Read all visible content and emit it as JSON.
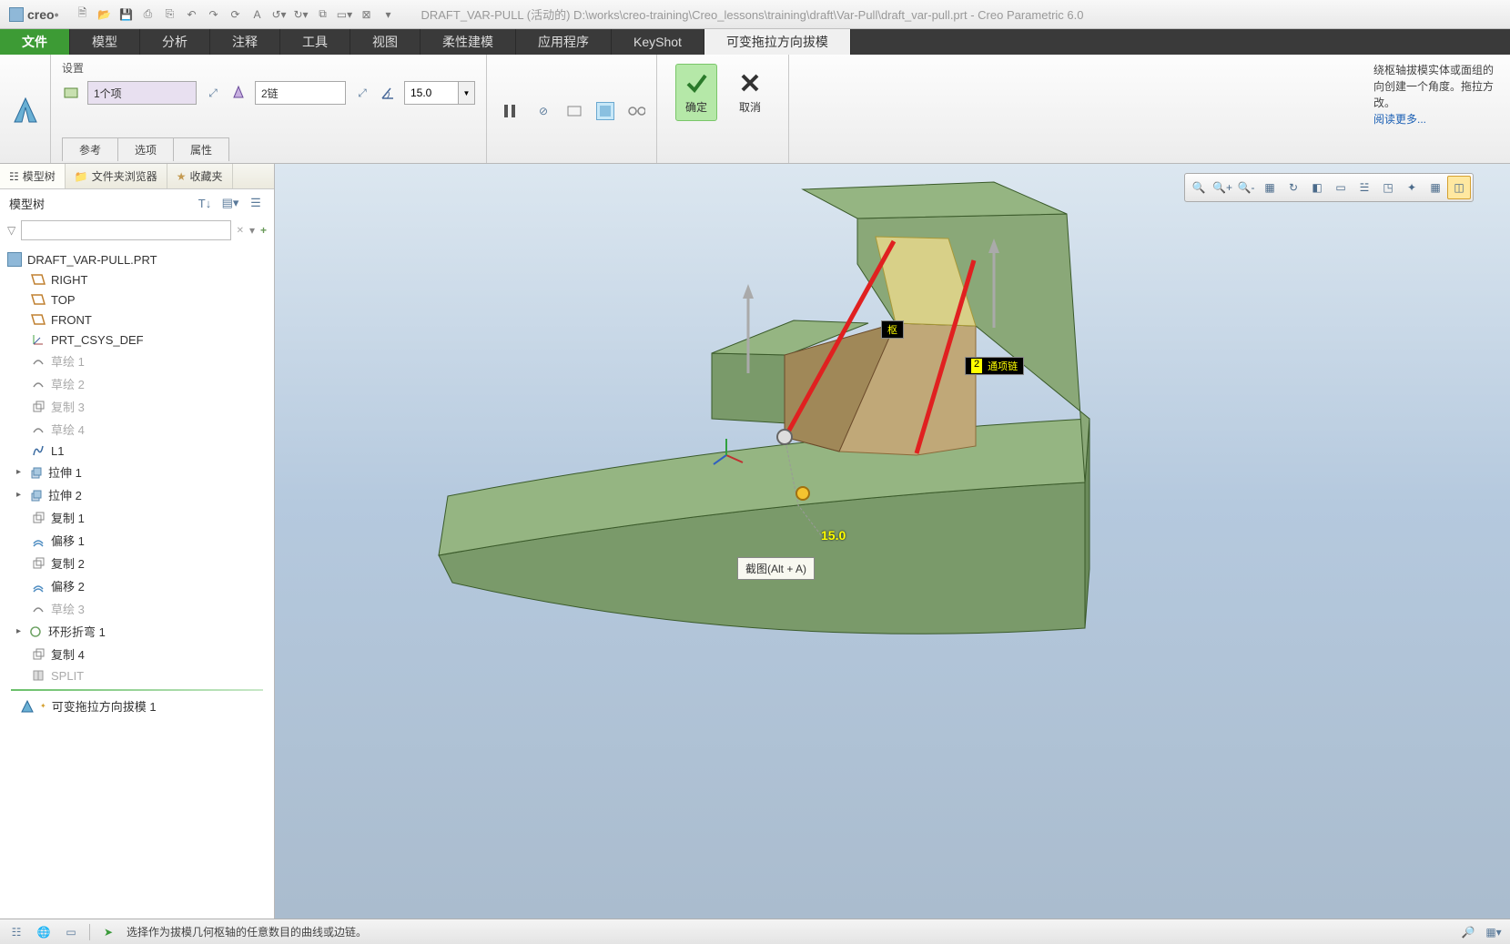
{
  "app": {
    "logo": "creo",
    "title": "DRAFT_VAR-PULL (活动的) D:\\works\\creo-training\\Creo_lessons\\training\\draft\\Var-Pull\\draft_var-pull.prt - Creo Parametric 6.0"
  },
  "ribbon_tabs": {
    "file": "文件",
    "items": [
      "模型",
      "分析",
      "注释",
      "工具",
      "视图",
      "柔性建模",
      "应用程序",
      "KeyShot",
      "可变拖拉方向拔模"
    ],
    "active_index": 8
  },
  "ribbon": {
    "settings_label": "设置",
    "field1": "1个项",
    "field2": "2链",
    "angle": "15.0",
    "sub_tabs": [
      "参考",
      "选项",
      "属性"
    ],
    "ok": "确定",
    "cancel": "取消",
    "help_text": "绕枢轴拔模实体或面组的向创建一个角度。拖拉方改。",
    "help_link": "阅读更多..."
  },
  "left_panel": {
    "tabs": [
      "模型树",
      "文件夹浏览器",
      "收藏夹"
    ],
    "header": "模型树",
    "root": "DRAFT_VAR-PULL.PRT",
    "items": [
      {
        "label": "RIGHT",
        "icon": "plane",
        "dim": false
      },
      {
        "label": "TOP",
        "icon": "plane",
        "dim": false
      },
      {
        "label": "FRONT",
        "icon": "plane",
        "dim": false
      },
      {
        "label": "PRT_CSYS_DEF",
        "icon": "csys",
        "dim": false
      },
      {
        "label": "草绘 1",
        "icon": "sketch",
        "dim": true
      },
      {
        "label": "草绘 2",
        "icon": "sketch",
        "dim": true
      },
      {
        "label": "复制 3",
        "icon": "copy",
        "dim": true
      },
      {
        "label": "草绘 4",
        "icon": "sketch",
        "dim": true
      },
      {
        "label": "L1",
        "icon": "curve",
        "dim": false
      },
      {
        "label": "拉伸 1",
        "icon": "extrude",
        "dim": false,
        "exp": true
      },
      {
        "label": "拉伸 2",
        "icon": "extrude",
        "dim": false,
        "exp": true
      },
      {
        "label": "复制 1",
        "icon": "copy",
        "dim": false
      },
      {
        "label": "偏移 1",
        "icon": "offset",
        "dim": false
      },
      {
        "label": "复制 2",
        "icon": "copy",
        "dim": false
      },
      {
        "label": "偏移 2",
        "icon": "offset",
        "dim": false
      },
      {
        "label": "草绘 3",
        "icon": "sketch",
        "dim": true
      },
      {
        "label": "环形折弯 1",
        "icon": "bend",
        "dim": false,
        "exp": true
      },
      {
        "label": "复制 4",
        "icon": "copy",
        "dim": false
      },
      {
        "label": "SPLIT",
        "icon": "split",
        "dim": true
      }
    ],
    "current_feature": "可变拖拉方向拔模 1"
  },
  "viewport": {
    "label1": "枢",
    "label2": "2",
    "label2b": "通项链",
    "angle_dim": "15.0",
    "hint": "截图(Alt + A)"
  },
  "statusbar": {
    "message": "选择作为拔模几何枢轴的任意数目的曲线或边链。"
  }
}
